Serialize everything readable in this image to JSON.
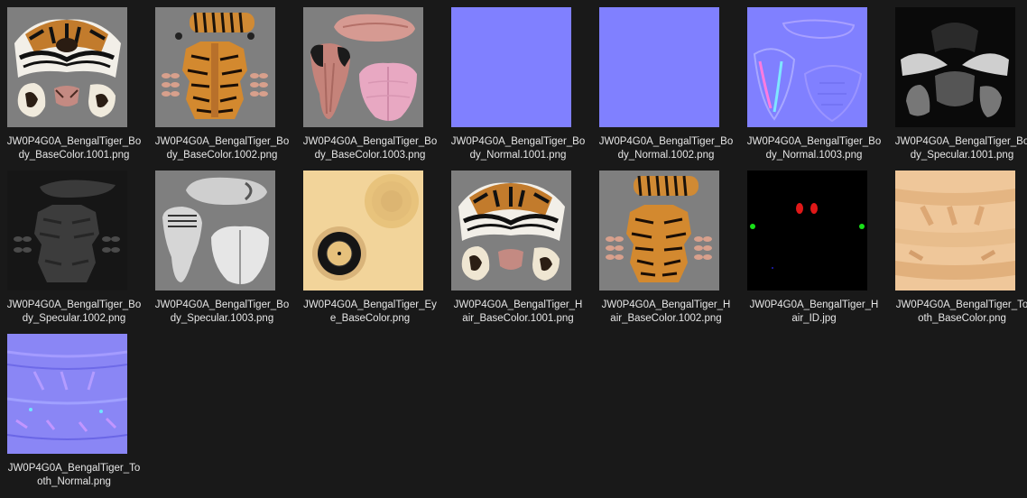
{
  "files": [
    {
      "name": "JW0P4G0A_BengalTiger_Bo\ndy_BaseColor.1001.png",
      "icon": "tiger-body-basecolor-1001-thumbnail"
    },
    {
      "name": "JW0P4G0A_BengalTiger_Bo\ndy_BaseColor.1002.png",
      "icon": "tiger-body-basecolor-1002-thumbnail"
    },
    {
      "name": "JW0P4G0A_BengalTiger_Bo\ndy_BaseColor.1003.png",
      "icon": "tiger-body-basecolor-1003-thumbnail"
    },
    {
      "name": "JW0P4G0A_BengalTiger_Bo\ndy_Normal.1001.png",
      "icon": "tiger-body-normal-1001-thumbnail"
    },
    {
      "name": "JW0P4G0A_BengalTiger_Bo\ndy_Normal.1002.png",
      "icon": "tiger-body-normal-1002-thumbnail"
    },
    {
      "name": "JW0P4G0A_BengalTiger_Bo\ndy_Normal.1003.png",
      "icon": "tiger-body-normal-1003-thumbnail"
    },
    {
      "name": "JW0P4G0A_BengalTiger_Bo\ndy_Specular.1001.png",
      "icon": "tiger-body-specular-1001-thumbnail"
    },
    {
      "name": "JW0P4G0A_BengalTiger_Bo\ndy_Specular.1002.png",
      "icon": "tiger-body-specular-1002-thumbnail"
    },
    {
      "name": "JW0P4G0A_BengalTiger_Bo\ndy_Specular.1003.png",
      "icon": "tiger-body-specular-1003-thumbnail"
    },
    {
      "name": "JW0P4G0A_BengalTiger_Ey\ne_BaseColor.png",
      "icon": "tiger-eye-basecolor-thumbnail"
    },
    {
      "name": "JW0P4G0A_BengalTiger_H\nair_BaseColor.1001.png",
      "icon": "tiger-hair-basecolor-1001-thumbnail"
    },
    {
      "name": "JW0P4G0A_BengalTiger_H\nair_BaseColor.1002.png",
      "icon": "tiger-hair-basecolor-1002-thumbnail"
    },
    {
      "name": "JW0P4G0A_BengalTiger_H\nair_ID.jpg",
      "icon": "tiger-hair-id-thumbnail"
    },
    {
      "name": "JW0P4G0A_BengalTiger_To\noth_BaseColor.png",
      "icon": "tiger-tooth-basecolor-thumbnail"
    },
    {
      "name": "JW0P4G0A_BengalTiger_To\noth_Normal.png",
      "icon": "tiger-tooth-normal-thumbnail"
    }
  ],
  "colors": {
    "background": "#191919",
    "text": "#e6e6e6",
    "normal_map": "#8080ff",
    "texture_gray": "#7f7f7f",
    "tiger_orange": "#c8791e"
  }
}
